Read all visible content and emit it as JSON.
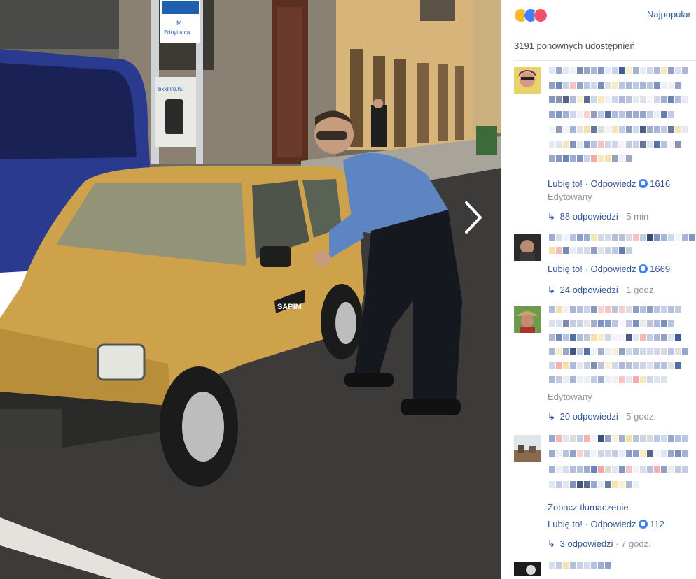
{
  "post": {
    "sort_label": "Najpopular",
    "shares_text": "3191 ponownych udostępnień",
    "reactions": [
      {
        "name": "haha",
        "color": "#f7b928"
      },
      {
        "name": "like",
        "color": "#4080ff"
      },
      {
        "name": "love",
        "color": "#f25268"
      }
    ]
  },
  "photo": {
    "street_sign_top": "M",
    "street_sign_name": "Zrínyi utca",
    "poster_text": "bkkinfo.hu",
    "car_sticker": "SAPIM",
    "next_icon": "chevron-right-icon"
  },
  "comments": [
    {
      "like_label": "Lubię to!",
      "reply_label": "Odpowiedz",
      "like_count": "1616",
      "edited_label": "Edytowany",
      "replies_text": "88 odpowiedzi",
      "replies_time": "5 min"
    },
    {
      "like_label": "Lubię to!",
      "reply_label": "Odpowiedz",
      "like_count": "1669",
      "replies_text": "24 odpowiedzi",
      "replies_time": "1 godz."
    },
    {
      "edited_label": "Edytowany",
      "replies_text": "20 odpowiedzi",
      "replies_time": "5 godz."
    },
    {
      "translate_label": "Zobacz tłumaczenie",
      "like_label": "Lubię to!",
      "reply_label": "Odpowiedz",
      "like_count": "112",
      "replies_text": "3 odpowiedzi",
      "replies_time": "7 godz."
    }
  ],
  "separator": "·"
}
